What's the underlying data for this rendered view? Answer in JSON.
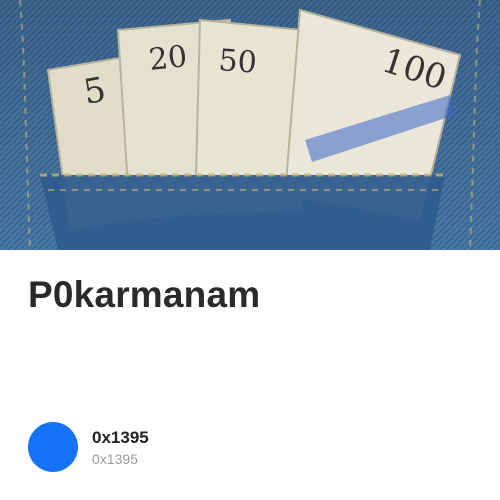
{
  "hero": {
    "image_description": "banknotes in jeans pocket",
    "denoms": [
      "5",
      "20",
      "50",
      "100"
    ]
  },
  "title": "P0karmanam",
  "owner": {
    "primary": "0x1395",
    "secondary": "0x1395",
    "avatar_color": "#1672f7"
  },
  "colors": {
    "denim": "#3f6f9f",
    "denim_dark": "#2c5685",
    "bill": "#e6e3d2",
    "bill_shade": "#c9c6b1",
    "text": "#2a2a2a",
    "muted": "#9b9b9b"
  }
}
